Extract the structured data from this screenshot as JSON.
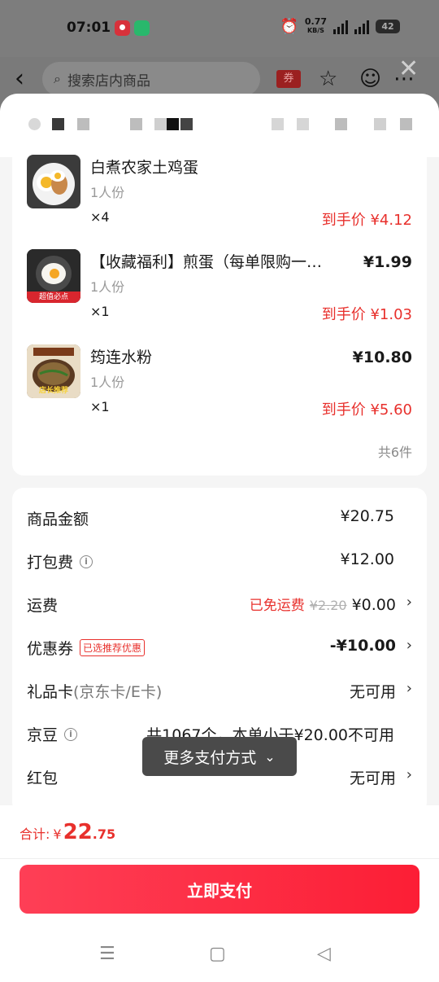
{
  "status_bar": {
    "time": "07:01",
    "net_speed": "0.77",
    "net_unit": "KB/S",
    "sig1": "5G",
    "sig2": "5G",
    "battery": "42"
  },
  "header": {
    "search_placeholder": "搜索店内商品",
    "coupon_label": "券"
  },
  "items": [
    {
      "name": "白煮农家土鸡蛋",
      "spec": "1人份",
      "qty": "×4",
      "price": "",
      "final_price": "到手价 ¥4.12"
    },
    {
      "name": "【收藏福利】煎蛋（每单限购一…",
      "spec": "1人份",
      "qty": "×1",
      "price": "¥1.99",
      "final_price": "到手价 ¥1.03",
      "thumb_text": "超值必点"
    },
    {
      "name": "筠连水粉",
      "spec": "1人份",
      "qty": "×1",
      "price": "¥10.80",
      "final_price": "到手价 ¥5.60",
      "thumb_text": "店长推荐"
    }
  ],
  "item_count": "共6件",
  "summary": {
    "goods_amount": {
      "label": "商品金额",
      "value": "¥20.75"
    },
    "packing_fee": {
      "label": "打包费",
      "value": "¥12.00"
    },
    "shipping": {
      "label": "运费",
      "free_text": "已免运费",
      "original": "¥2.20",
      "value": "¥0.00"
    },
    "coupon": {
      "label": "优惠券",
      "badge": "已选推荐优惠",
      "value": "-¥10.00"
    },
    "gift_card": {
      "label": "礼品卡",
      "sub": "(京东卡/E卡)",
      "value": "无可用"
    },
    "jd_beans": {
      "label": "京豆",
      "value": "共1067个，本单小于¥20.00不可用"
    },
    "red_packet": {
      "label": "红包",
      "value": "无可用"
    }
  },
  "more_pay": "更多支付方式",
  "footer": {
    "total_label": "合计:",
    "currency": "¥",
    "total_int": "22",
    "total_dec": ".75",
    "pay_button": "立即支付"
  }
}
